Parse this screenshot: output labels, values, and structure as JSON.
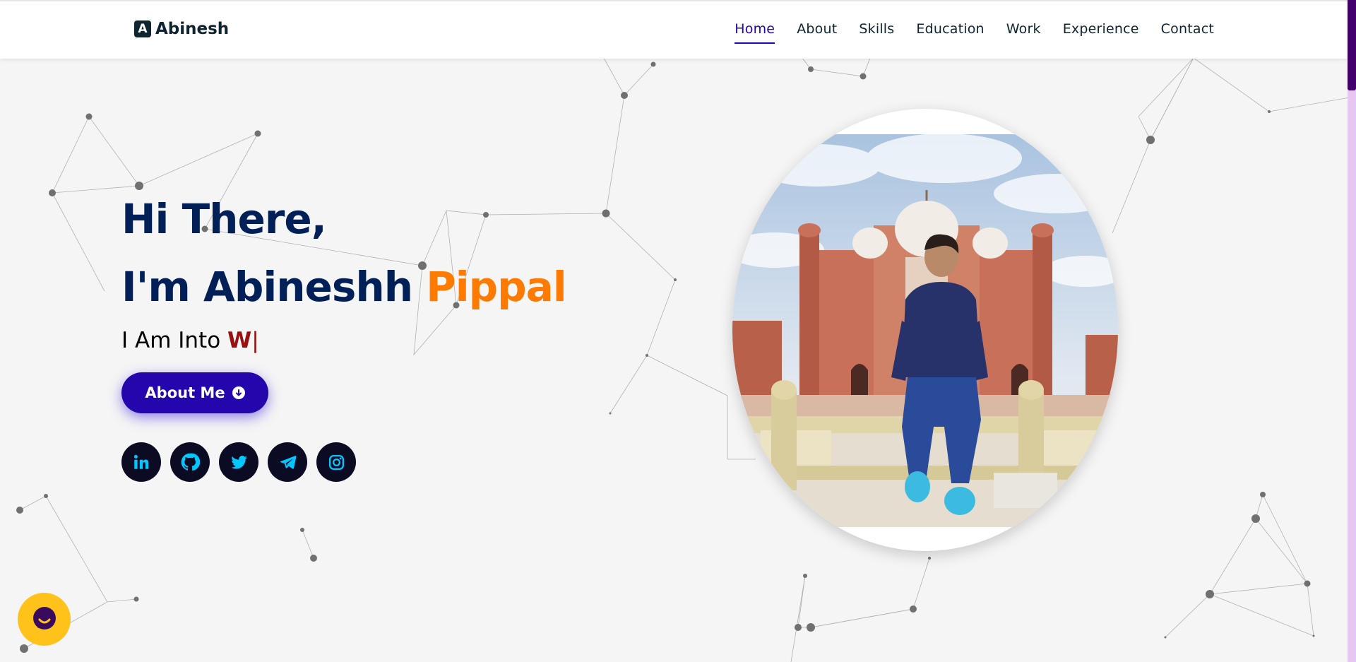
{
  "brand": {
    "icon_letter": "A",
    "name": "Abinesh"
  },
  "nav": {
    "items": [
      {
        "label": "Home",
        "active": true
      },
      {
        "label": "About",
        "active": false
      },
      {
        "label": "Skills",
        "active": false
      },
      {
        "label": "Education",
        "active": false
      },
      {
        "label": "Work",
        "active": false
      },
      {
        "label": "Experience",
        "active": false
      },
      {
        "label": "Contact",
        "active": false
      }
    ]
  },
  "hero": {
    "greeting": "Hi There,",
    "intro_prefix": "I'm Abineshh",
    "intro_highlight": "Pippal",
    "typing_prefix": "I Am Into",
    "typing_text": "W",
    "cursor": "|",
    "button_label": "About Me",
    "button_icon": "arrow-down-circle-icon"
  },
  "socials": [
    {
      "name": "linkedin-icon"
    },
    {
      "name": "github-icon"
    },
    {
      "name": "twitter-icon"
    },
    {
      "name": "telegram-icon"
    },
    {
      "name": "instagram-icon"
    }
  ],
  "colors": {
    "heading": "#002057",
    "highlight": "#ff7a00",
    "typed": "#991010",
    "accent": "#2506ad",
    "social_bg": "#0b0b24",
    "social_icon": "#00c8ff",
    "chat": "#ffc21a",
    "scroll_thumb": "#42006c"
  },
  "photo": {
    "alt": "profile photo"
  }
}
